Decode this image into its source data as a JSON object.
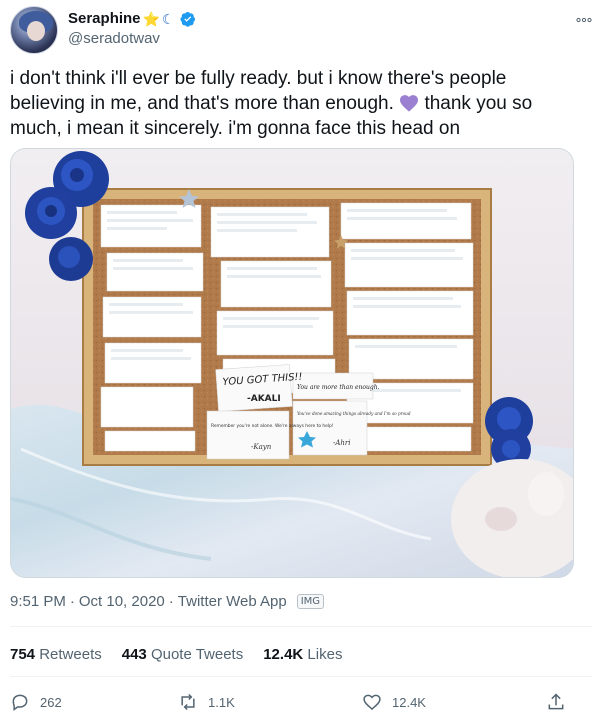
{
  "author": {
    "display_name": "Seraphine",
    "emojis": [
      "⭐",
      "☾"
    ],
    "handle": "@seradotwav",
    "verified": true
  },
  "tweet": {
    "text_before_emoji": "i don't think i'll ever be fully ready. but i know there's people believing in me, and that's more than enough. ",
    "text_after_emoji": " thank you so much, i mean it sincerely. i'm gonna face this head on",
    "emoji_icon": "purple-heart-icon",
    "timestamp": "9:51 PM",
    "date": "Oct 10, 2020",
    "source": "Twitter Web App",
    "badge": "IMG"
  },
  "stats": {
    "retweets_count": "754",
    "retweets_label": "Retweets",
    "quotes_count": "443",
    "quotes_label": "Quote Tweets",
    "likes_count": "12.4K",
    "likes_label": "Likes"
  },
  "actions": {
    "reply_count": "262",
    "retweet_count": "1.1K",
    "like_count": "12.4K"
  },
  "media": {
    "board_notes": {
      "note_1": "YOU GOT THIS!!",
      "note_1_sign": "-AKALI",
      "note_2": "You are more than enough.",
      "note_3": "Remember you're not alone. We're always here to help!",
      "note_3_sign": "-Kayn",
      "note_4": "You've done amazing things already and I'm so proud",
      "note_4_sign": "-Ahri"
    }
  },
  "colors": {
    "accent": "#1d9bf0",
    "heart": "#9b7fd1",
    "star": "#f4b23a"
  }
}
